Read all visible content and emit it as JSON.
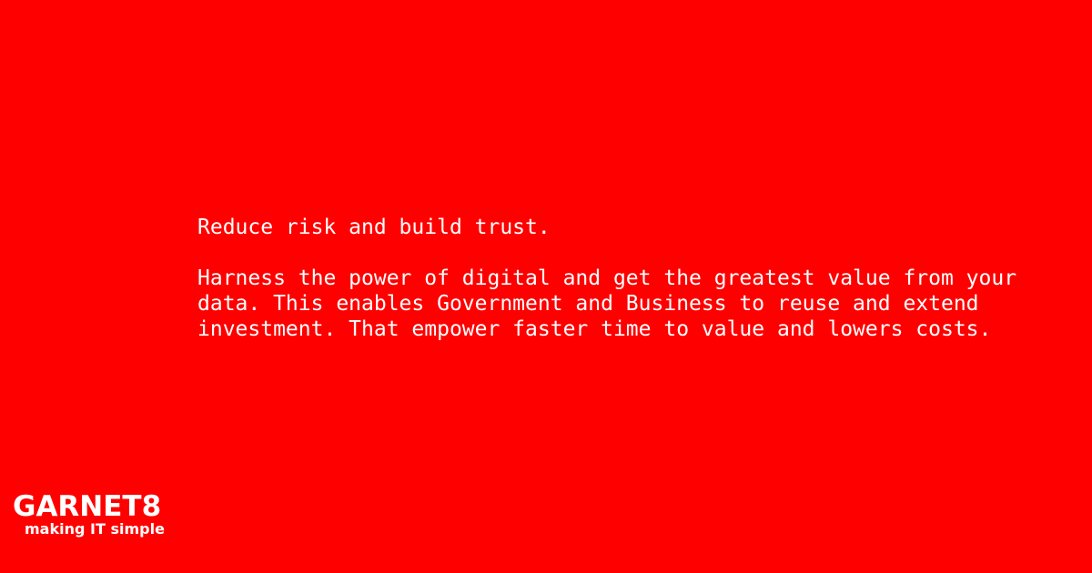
{
  "colors": {
    "background": "#ff0000",
    "text": "#ffffff"
  },
  "message": {
    "headline": "Reduce risk and build trust.",
    "body_lines": [
      "Harness the power of digital and get the greatest value from your",
      "data. This enables Government and Business to reuse and extend",
      "investment. That empower faster time to value and lowers costs."
    ]
  },
  "logo": {
    "wordmark": "GARNET8",
    "tagline": "making IT simple"
  }
}
